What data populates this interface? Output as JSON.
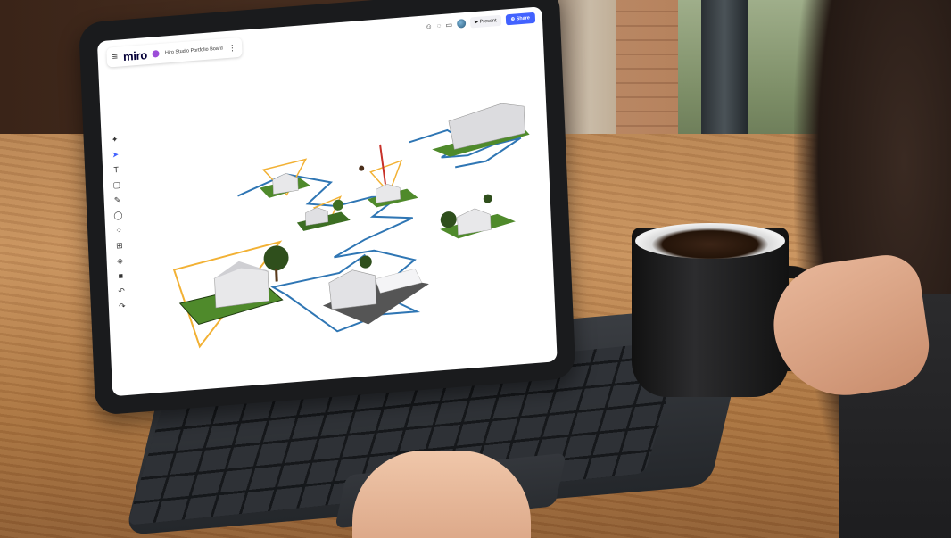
{
  "board": {
    "app_name": "miro",
    "title": "Hiro Studio Portfolio Board",
    "present_label": "Present",
    "share_label": "Share"
  },
  "icons": {
    "menu": "hamburger-icon",
    "board": "board-icon",
    "more": "kebab-icon",
    "reactions": "reactions-icon",
    "chat": "chat-icon",
    "video": "video-icon",
    "avatar": "avatar",
    "play": "play-icon",
    "share": "share-icon"
  },
  "tools": [
    {
      "name": "magic-icon",
      "glyph": "✦"
    },
    {
      "name": "select-icon",
      "glyph": "➤"
    },
    {
      "name": "text-icon",
      "glyph": "T"
    },
    {
      "name": "sticky-note-icon",
      "glyph": "▢"
    },
    {
      "name": "pen-icon",
      "glyph": "✎"
    },
    {
      "name": "comment-icon",
      "glyph": "◯"
    },
    {
      "name": "shapes-icon",
      "glyph": "⁘"
    },
    {
      "name": "frame-icon",
      "glyph": "⊞"
    },
    {
      "name": "layers-icon",
      "glyph": "◈"
    },
    {
      "name": "add-icon",
      "glyph": "■"
    },
    {
      "name": "undo-icon",
      "glyph": "↶"
    },
    {
      "name": "redo-icon",
      "glyph": "↷"
    }
  ],
  "colors": {
    "accent": "#4262ff",
    "frame_blue": "#2f76b4",
    "frame_orange": "#f2b134",
    "grass": "#4f8a2b"
  }
}
